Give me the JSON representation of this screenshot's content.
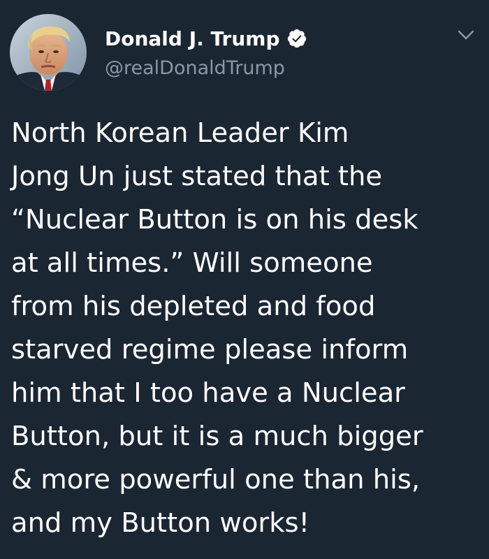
{
  "tweet": {
    "author": {
      "display_name": "Donald J. Trump",
      "handle": "@realDonaldTrump",
      "verified": true,
      "avatar_icon": "profile-photo"
    },
    "menu_icon": "chevron-down-icon",
    "text_lines": [
      "North Korean Leader Kim",
      "Jong Un just stated that the",
      "“Nuclear Button is on his desk",
      "at all times.” Will someone",
      "from his depleted and food",
      "starved regime please inform",
      "him that I too have a Nuclear",
      "Button, but it is a much bigger",
      "& more powerful one than his,",
      "and my Button works!"
    ]
  },
  "colors": {
    "background": "#1b2633",
    "text": "#ffffff",
    "handle": "#8899a6",
    "caret": "#8899a6"
  }
}
